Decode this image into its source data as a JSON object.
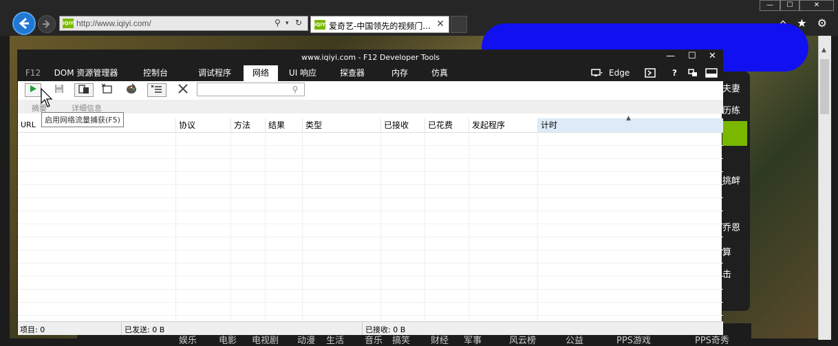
{
  "browser": {
    "address_url": "http://www.iqiyi.com/",
    "favicon_text": "iQIYI",
    "tab_title": "爱奇艺-中国领先的视频门...",
    "tab_close": "✕",
    "nav_icons": {
      "back": "back-arrow-icon",
      "forward": "forward-arrow-icon"
    },
    "address_icons": [
      "search-icon",
      "dropdown-icon",
      "refresh-icon"
    ],
    "window_controls": [
      "minimize",
      "maximize",
      "close"
    ],
    "toolbar_icons": [
      "home-icon",
      "favorites-star-icon",
      "settings-gear-icon"
    ]
  },
  "page_side_text": [
    "夫妻",
    "历练",
    "挑衅",
    "乔恩",
    "算",
    "击"
  ],
  "page_bottom_nav": [
    "娱乐",
    "电影",
    "电视剧",
    "动漫",
    "生活",
    "音乐",
    "搞笑",
    "财经",
    "军事",
    "风云榜",
    "公益",
    "PPS游戏",
    "PPS奇秀"
  ],
  "devtools": {
    "title": "www.iqiyi.com - F12 Developer Tools",
    "window_controls": {
      "minimize": "—",
      "maximize": "☐",
      "close": "✕"
    },
    "tabs": [
      {
        "label": "F12"
      },
      {
        "label": "DOM 资源管理器"
      },
      {
        "label": "控制台"
      },
      {
        "label": "调试程序"
      },
      {
        "label": "网络"
      },
      {
        "label": "UI 响应"
      },
      {
        "label": "探查器"
      },
      {
        "label": "内存"
      },
      {
        "label": "仿真"
      }
    ],
    "active_tab": "网络",
    "emulation_mode": "Edge",
    "right_icons": [
      "screen-target-icon",
      "console-icon",
      "help-icon",
      "undock-icon",
      "dock-icon"
    ],
    "help_label": "?",
    "toolbar": {
      "buttons": [
        "start-capture",
        "save",
        "import",
        "clear-on-navigate",
        "clear-cache",
        "always-refresh",
        "clear-session"
      ],
      "filter_placeholder": ""
    },
    "subbar": {
      "summary_label": "摘要",
      "details_label": "详细信息"
    },
    "tooltip": "启用网络流量捕获(F5)",
    "columns": [
      "URL",
      "协议",
      "方法",
      "结果",
      "类型",
      "已接收",
      "已花费",
      "发起程序",
      "计时"
    ],
    "sorted_column": "计时",
    "status": {
      "items": "项目: 0",
      "sent": "已发送: 0 B",
      "received": "已接收: 0 B"
    }
  }
}
